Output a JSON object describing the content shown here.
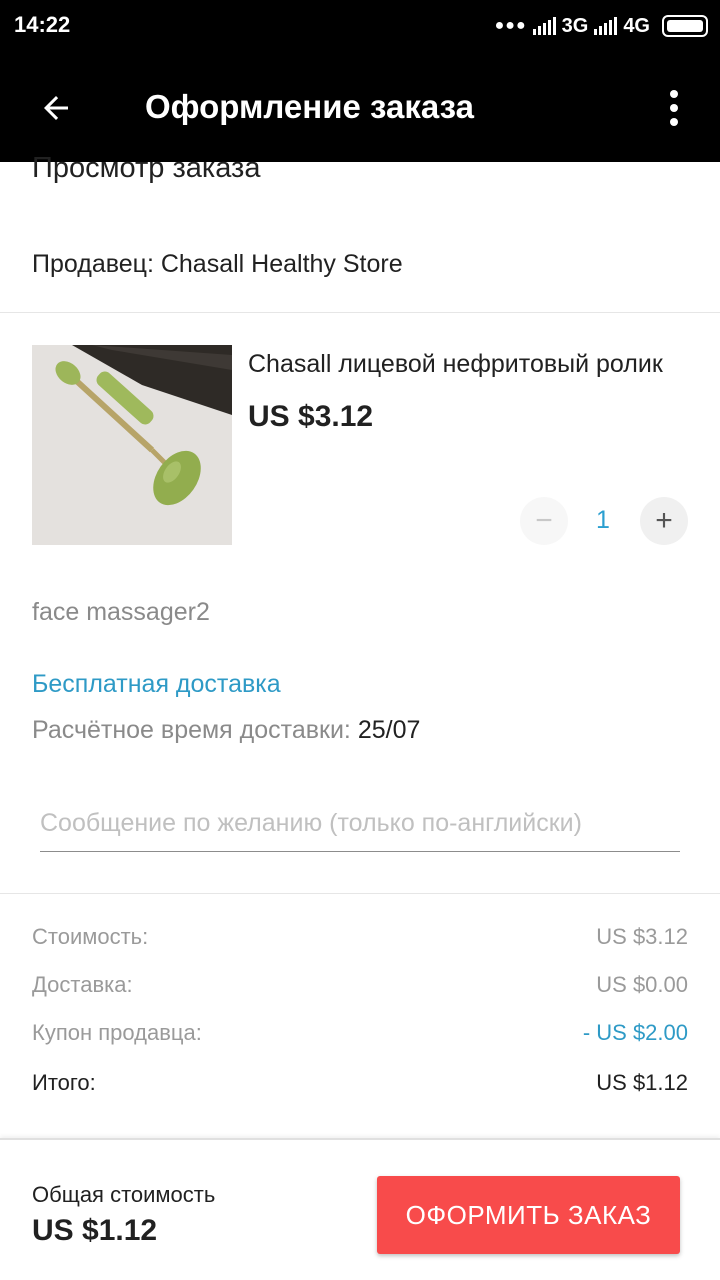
{
  "status_bar": {
    "time": "14:22",
    "network_3g": "3G",
    "network_4g": "4G"
  },
  "app_bar": {
    "title": "Оформление заказа",
    "back_icon": "arrow-back-icon",
    "more_icon": "more-vert-icon"
  },
  "order": {
    "section_title": "Просмотр заказа",
    "seller": "Продавец: Chasall Healthy Store"
  },
  "product": {
    "name": "Chasall лицевой нефритовый ролик",
    "price": "US $3.12",
    "quantity": "1",
    "variant": "face massager2"
  },
  "shipping": {
    "free_label": "Бесплатная доставка",
    "eta_label": "Расчётное время доставки:",
    "eta_value": "25/07"
  },
  "message": {
    "placeholder": "Сообщение по желанию (только по-английски)"
  },
  "summary": {
    "cost_label": "Стоимость:",
    "cost_value": "US $3.12",
    "shipping_label": "Доставка:",
    "shipping_value": "US $0.00",
    "coupon_label": "Купон продавца:",
    "coupon_value": "- US $2.00",
    "total_label": "Итого:",
    "total_value": "US $1.12"
  },
  "footer": {
    "total_label": "Общая стоимость",
    "total_value": "US $1.12",
    "checkout_label": "ОФОРМИТЬ ЗАКАЗ"
  },
  "colors": {
    "accent_blue": "#2e9ac6",
    "checkout_red": "#f84b4b"
  }
}
